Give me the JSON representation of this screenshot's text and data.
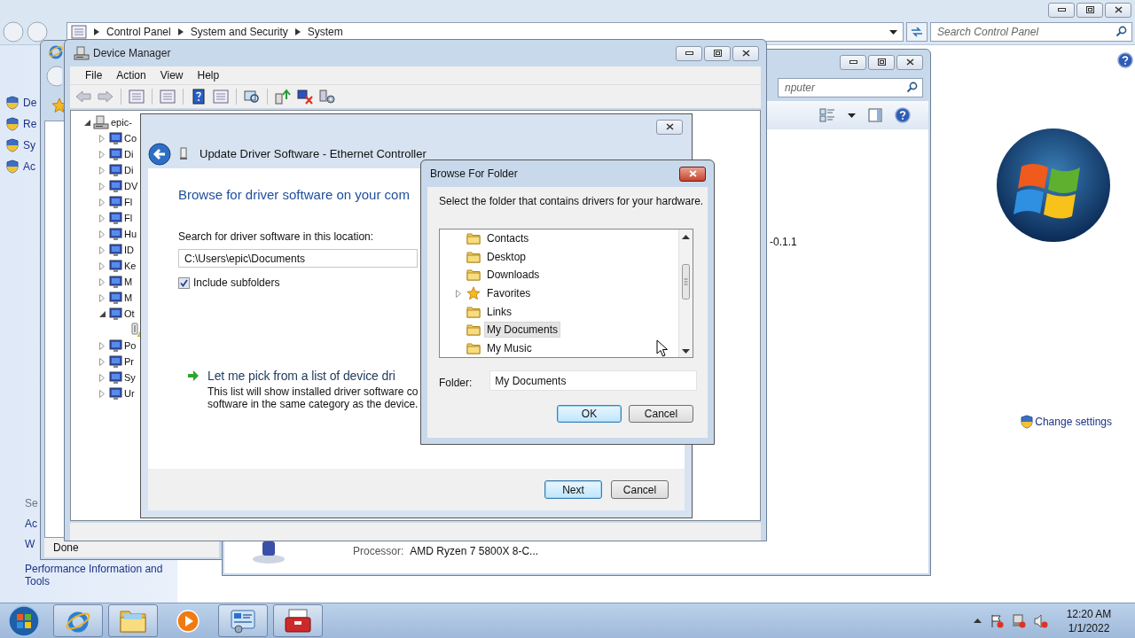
{
  "control_panel": {
    "breadcrumb": [
      {
        "label": "Control Panel"
      },
      {
        "label": "System and Security"
      },
      {
        "label": "System"
      }
    ],
    "search": {
      "placeholder": "Search Control Panel"
    },
    "tasks": [
      "De",
      "Re",
      "Sy",
      "Ac"
    ],
    "see_also": {
      "heading": "Se",
      "links": [
        "Ac",
        "W",
        "Performance Information and Tools"
      ]
    },
    "change_settings": "Change settings"
  },
  "browser": {
    "status": "Done"
  },
  "system_window": {
    "search": {
      "placeholder": "nputer"
    },
    "column_1": "-0.1.1",
    "processor": {
      "label": "Processor:",
      "value": "AMD Ryzen 7 5800X 8-C..."
    }
  },
  "device_manager": {
    "title": "Device Manager",
    "menu": [
      "File",
      "Action",
      "View",
      "Help"
    ],
    "tree": {
      "label": "epic-",
      "expanded": true,
      "children": [
        {
          "label": "Co",
          "expanded": false
        },
        {
          "label": "Di",
          "expanded": false
        },
        {
          "label": "Di",
          "expanded": false
        },
        {
          "label": "DV",
          "expanded": false
        },
        {
          "label": "Fl",
          "expanded": false
        },
        {
          "label": "Fl",
          "expanded": false
        },
        {
          "label": "Hu",
          "expanded": false
        },
        {
          "label": "ID",
          "expanded": false
        },
        {
          "label": "Ke",
          "expanded": false
        },
        {
          "label": "M",
          "expanded": false
        },
        {
          "label": "M",
          "expanded": false
        },
        {
          "label": "Ot",
          "expanded": true,
          "children": [
            {
              "warning": true
            }
          ]
        },
        {
          "label": "Po",
          "expanded": false
        },
        {
          "label": "Pr",
          "expanded": false
        },
        {
          "label": "Sy",
          "expanded": false
        },
        {
          "label": "Ur",
          "expanded": false
        }
      ]
    }
  },
  "update_driver": {
    "title": "Update Driver Software - Ethernet Controller",
    "heading": "Browse for driver software on your com",
    "location_label": "Search for driver software in this location:",
    "location": {
      "value": "C:\\Users\\epic\\Documents"
    },
    "include_subfolders": {
      "label": "Include subfolders",
      "checked": true
    },
    "pick_option": {
      "title": "Let me pick from a list of device dri",
      "description": [
        "This list will show installed driver software co",
        "software in the same category as the device."
      ]
    },
    "buttons": [
      {
        "label": "Next",
        "default": true
      },
      {
        "label": "Cancel",
        "default": false
      }
    ]
  },
  "browse_folder": {
    "title": "Browse For Folder",
    "prompt": "Select the folder that contains drivers for your hardware.",
    "folders": [
      {
        "label": "Contacts",
        "expandable": false,
        "selected": false
      },
      {
        "label": "Desktop",
        "expandable": false,
        "selected": false
      },
      {
        "label": "Downloads",
        "expandable": false,
        "selected": false
      },
      {
        "label": "Favorites",
        "expandable": true,
        "selected": false
      },
      {
        "label": "Links",
        "expandable": false,
        "selected": false
      },
      {
        "label": "My Documents",
        "expandable": false,
        "selected": true
      },
      {
        "label": "My Music",
        "expandable": false,
        "selected": false
      }
    ],
    "folder_label": "Folder:",
    "folder": {
      "value": "My Documents"
    },
    "buttons": [
      {
        "label": "OK",
        "default": true
      },
      {
        "label": "Cancel",
        "default": false
      }
    ]
  },
  "taskbar": {
    "apps": [
      {
        "kind": "browser",
        "running": true
      },
      {
        "kind": "folder",
        "running": true
      },
      {
        "kind": "media",
        "running": false
      },
      {
        "kind": "control-panel",
        "running": true
      },
      {
        "kind": "toolbox",
        "running": true
      }
    ],
    "clock": {
      "time": "12:20 AM",
      "date": "1/1/2022"
    }
  }
}
